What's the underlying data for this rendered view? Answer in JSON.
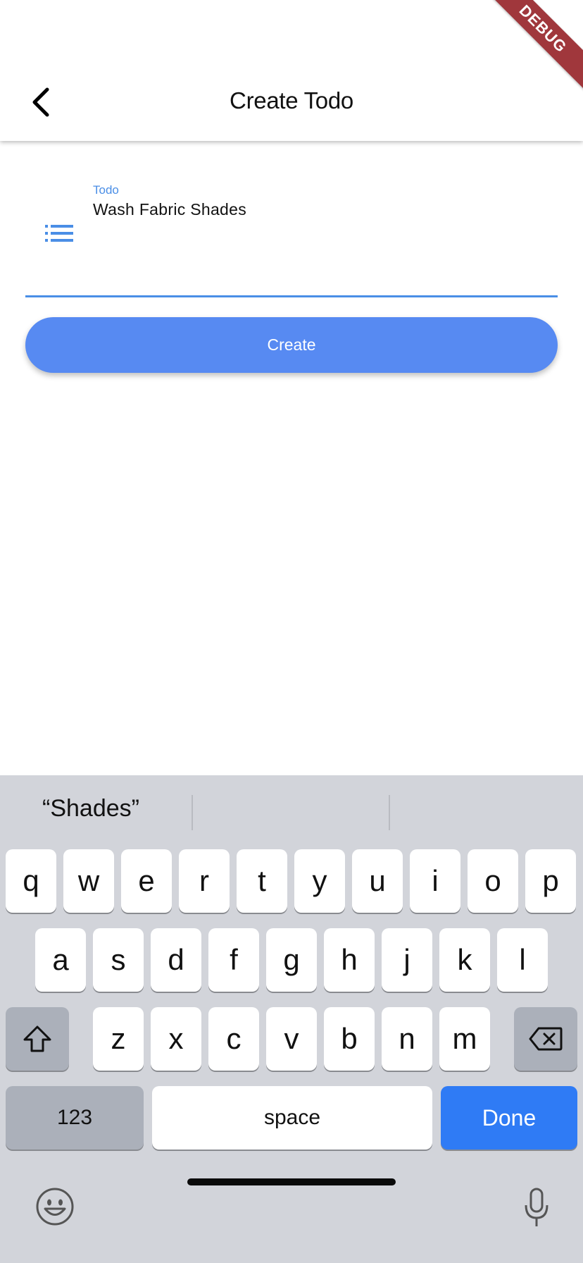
{
  "app_bar": {
    "title": "Create Todo",
    "back_icon": "chevron-left-icon"
  },
  "debug_banner": "DEBUG",
  "form": {
    "field_label": "Todo",
    "field_value": "Wash Fabric Shades",
    "field_icon": "list-icon",
    "accent_color": "#4a8ee6",
    "create_label": "Create",
    "create_color": "#578af2"
  },
  "keyboard": {
    "suggestions": [
      "“Shades”",
      "",
      ""
    ],
    "row1": [
      "q",
      "w",
      "e",
      "r",
      "t",
      "y",
      "u",
      "i",
      "o",
      "p"
    ],
    "row2": [
      "a",
      "s",
      "d",
      "f",
      "g",
      "h",
      "j",
      "k",
      "l"
    ],
    "row3": [
      "z",
      "x",
      "c",
      "v",
      "b",
      "n",
      "m"
    ],
    "shift_icon": "shift-icon",
    "delete_icon": "backspace-icon",
    "numbers_label": "123",
    "space_label": "space",
    "done_label": "Done",
    "done_color": "#2f7bf5",
    "emoji_icon": "emoji-icon",
    "mic_icon": "microphone-icon"
  }
}
